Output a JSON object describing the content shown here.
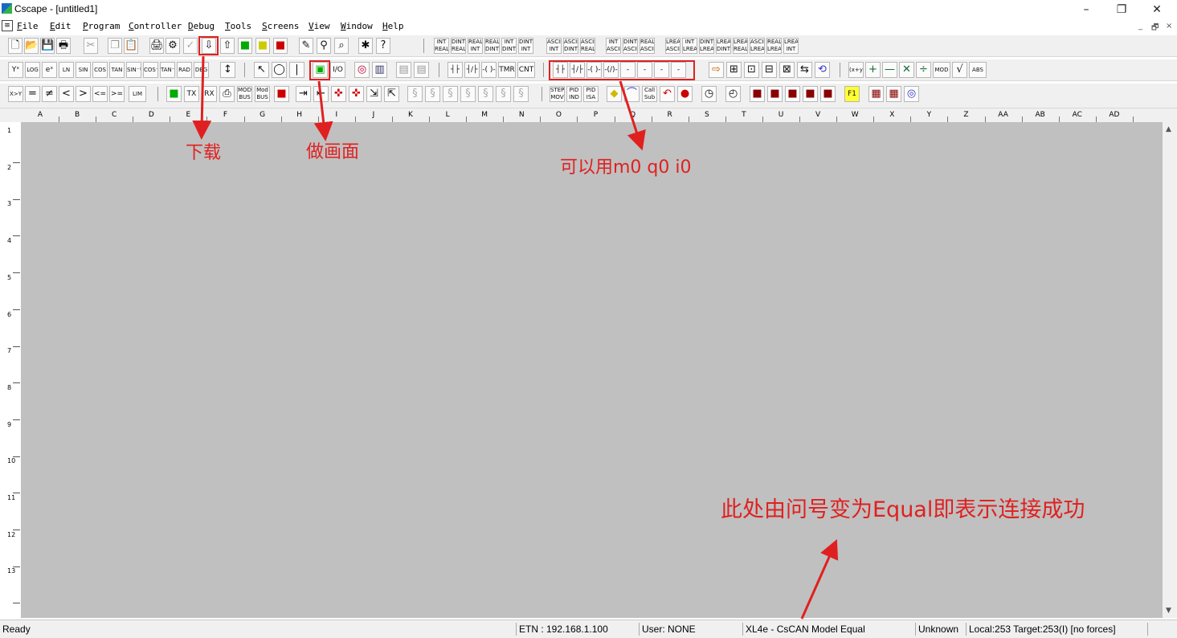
{
  "window": {
    "title": "Cscape - [untitled1]",
    "controls": [
      "–",
      "❐",
      "✕"
    ],
    "mdi_controls": [
      "_",
      "🗗",
      "×"
    ]
  },
  "menu": [
    {
      "label": "File",
      "u": "F",
      "rest": "ile"
    },
    {
      "label": "Edit",
      "u": "E",
      "rest": "dit"
    },
    {
      "label": "Program",
      "u": "P",
      "rest": "rogram"
    },
    {
      "label": "Controller",
      "u": "C",
      "rest": "ontroller"
    },
    {
      "label": "Debug",
      "u": "D",
      "rest": "ebug"
    },
    {
      "label": "Tools",
      "u": "T",
      "rest": "ools"
    },
    {
      "label": "Screens",
      "u": "S",
      "rest": "creens"
    },
    {
      "label": "View",
      "u": "V",
      "rest": "iew"
    },
    {
      "label": "Window",
      "u": "W",
      "rest": "indow"
    },
    {
      "label": "Help",
      "u": "H",
      "rest": "elp"
    }
  ],
  "toolbar1": {
    "conversions": [
      "INT REAL",
      "DINT REAL",
      "REAL INT",
      "REAL DINT",
      "INT DINT",
      "DINT INT",
      "ASCII INT",
      "ASCII DINT",
      "ASCII REAL",
      "INT ASCII",
      "DINT ASCII",
      "REAL ASCII",
      "LREAL ASCII",
      "INT LREAL",
      "DINT LREAL",
      "LREAL DINT",
      "LREAL REAL",
      "ASCII LREAL",
      "REAL LREAL",
      "LREAL INT"
    ]
  },
  "toolbar2": {
    "math": [
      "Yˣ",
      "LOG",
      "eˣ",
      "LN",
      "SIN",
      "COS",
      "TAN",
      "SIN⁻¹",
      "COS⁻¹",
      "TAN⁻¹",
      "RAD",
      "DEG"
    ],
    "contacts_plain": [
      "┤├",
      "┤/├",
      "-( )-",
      "TMR",
      "CNT"
    ],
    "contacts_highlighted": [
      "┤├",
      "┤/├",
      "-( )-",
      "-(/)-",
      "-(P)-",
      "-(N)-",
      "-(S)-",
      "-(R)-"
    ],
    "arith": [
      "(x+y)",
      "+",
      "—",
      "✕",
      "÷",
      "MOD",
      "√",
      "ABS"
    ]
  },
  "toolbar3": {
    "compare": [
      "X>Y",
      "=",
      "≠",
      "<",
      ">",
      "<=",
      ">=",
      "LIM"
    ],
    "comm": [
      "TX",
      "RX",
      "MOD BUS",
      "Mod BUS"
    ],
    "pid": [
      "STEP MOV",
      "PID IND",
      "PID ISA",
      "Call Sub"
    ]
  },
  "columns": [
    "A",
    "B",
    "C",
    "D",
    "E",
    "F",
    "G",
    "H",
    "I",
    "J",
    "K",
    "L",
    "M",
    "N",
    "O",
    "P",
    "Q",
    "R",
    "S",
    "T",
    "U",
    "V",
    "W",
    "X",
    "Y",
    "Z",
    "AA",
    "AB",
    "AC",
    "AD"
  ],
  "rows": [
    "1",
    "2",
    "3",
    "4",
    "5",
    "6",
    "7",
    "8",
    "9",
    "10",
    "11",
    "12",
    "13"
  ],
  "status": {
    "ready": "Ready",
    "etn": "ETN : 192.168.1.100",
    "user": "User: NONE",
    "model": "XL4e - CsCAN Model Equal",
    "unknown": "Unknown",
    "local": "Local:253  Target:253(I) [no forces]"
  },
  "annotations": {
    "download": "下载",
    "make_screen": "做画面",
    "use_m0": "可以用m0  q0  i0",
    "connect_ok": "此处由问号变为Equal即表示连接成功"
  },
  "colors": {
    "annotation_red": "#e02020",
    "canvas_gray": "#c0c0c0"
  }
}
